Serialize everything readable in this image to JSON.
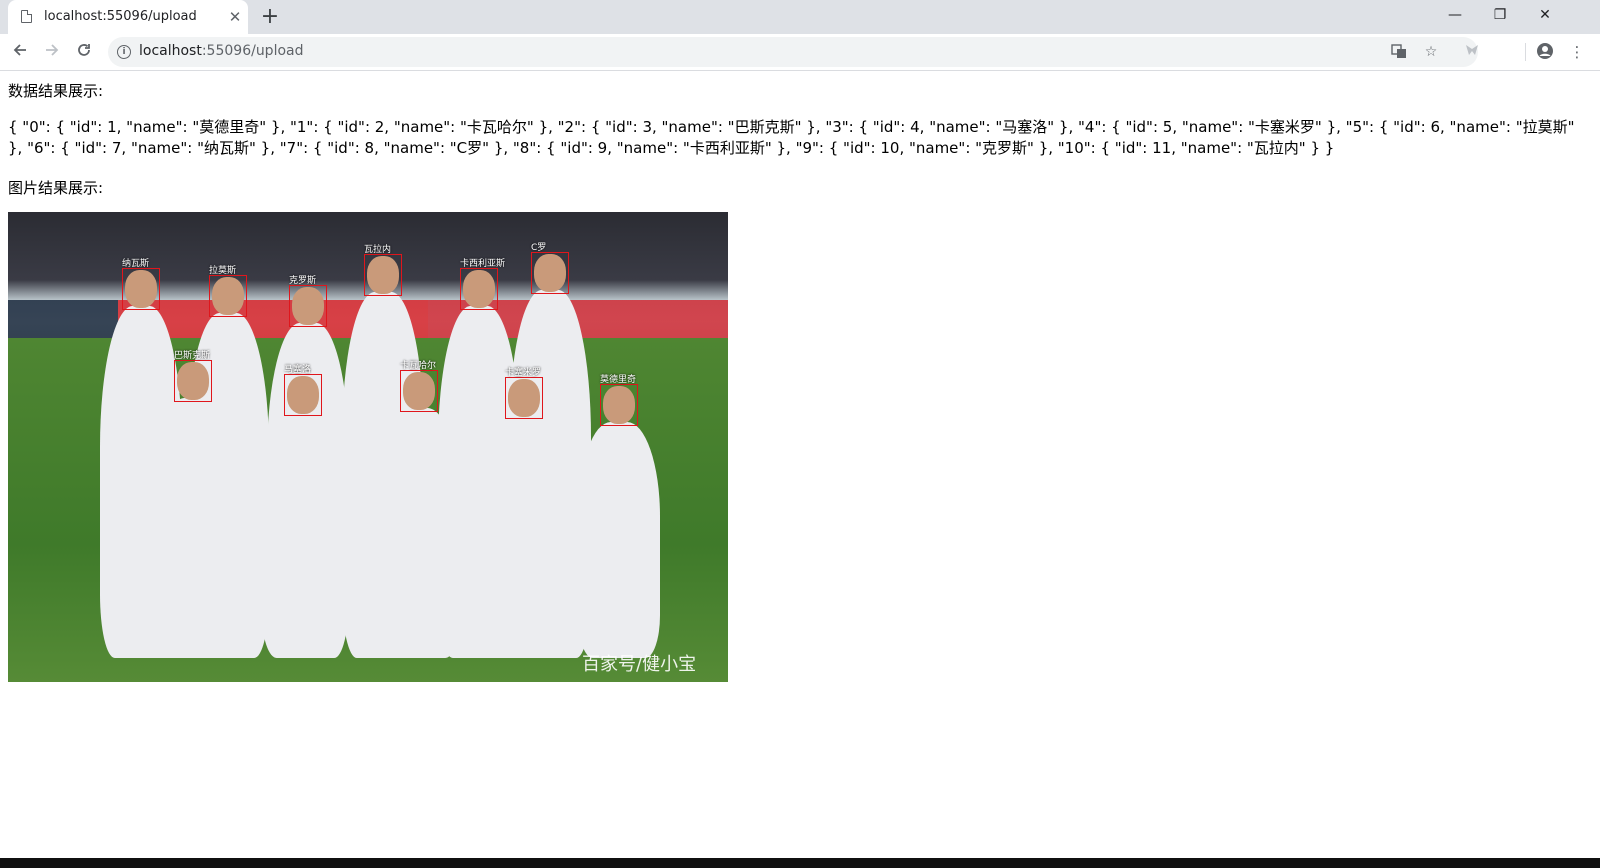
{
  "browser": {
    "tab_title": "localhost:55096/upload",
    "new_tab_symbol": "+",
    "close_tab_symbol": "✕",
    "url_host": "localhost",
    "url_rest": ":55096/upload",
    "window_controls": {
      "minimize": "—",
      "restore": "❐",
      "close": "✕"
    },
    "icons": [
      "page-icon",
      "back-icon",
      "forward-icon",
      "reload-icon",
      "info-icon",
      "translate-icon",
      "star-icon",
      "extension-icon",
      "profile-icon",
      "menu-icon"
    ]
  },
  "page": {
    "data_label": "数据结果展示:",
    "json_text": "{ \"0\": { \"id\": 1, \"name\": \"莫德里奇\" }, \"1\": { \"id\": 2, \"name\": \"卡瓦哈尔\" }, \"2\": { \"id\": 3, \"name\": \"巴斯克斯\" }, \"3\": { \"id\": 4, \"name\": \"马塞洛\" }, \"4\": { \"id\": 5, \"name\": \"卡塞米罗\" }, \"5\": { \"id\": 6, \"name\": \"拉莫斯\" }, \"6\": { \"id\": 7, \"name\": \"纳瓦斯\" }, \"7\": { \"id\": 8, \"name\": \"C罗\" }, \"8\": { \"id\": 9, \"name\": \"卡西利亚斯\" }, \"9\": { \"id\": 10, \"name\": \"克罗斯\" }, \"10\": { \"id\": 11, \"name\": \"瓦拉内\" } }",
    "image_label": "图片结果展示:",
    "watermark": "百家号/健小宝"
  },
  "faces": [
    {
      "name": "纳瓦斯"
    },
    {
      "name": "拉莫斯"
    },
    {
      "name": "克罗斯"
    },
    {
      "name": "瓦拉内"
    },
    {
      "name": "卡西利亚斯"
    },
    {
      "name": "C罗"
    },
    {
      "name": "巴斯克斯"
    },
    {
      "name": "马塞洛"
    },
    {
      "name": "卡瓦哈尔"
    },
    {
      "name": "卡塞米罗"
    },
    {
      "name": "莫德里奇"
    }
  ],
  "colors": {
    "face_box": "#e0161c",
    "tab_strip": "#dee1e6",
    "omnibox": "#f1f3f4"
  }
}
